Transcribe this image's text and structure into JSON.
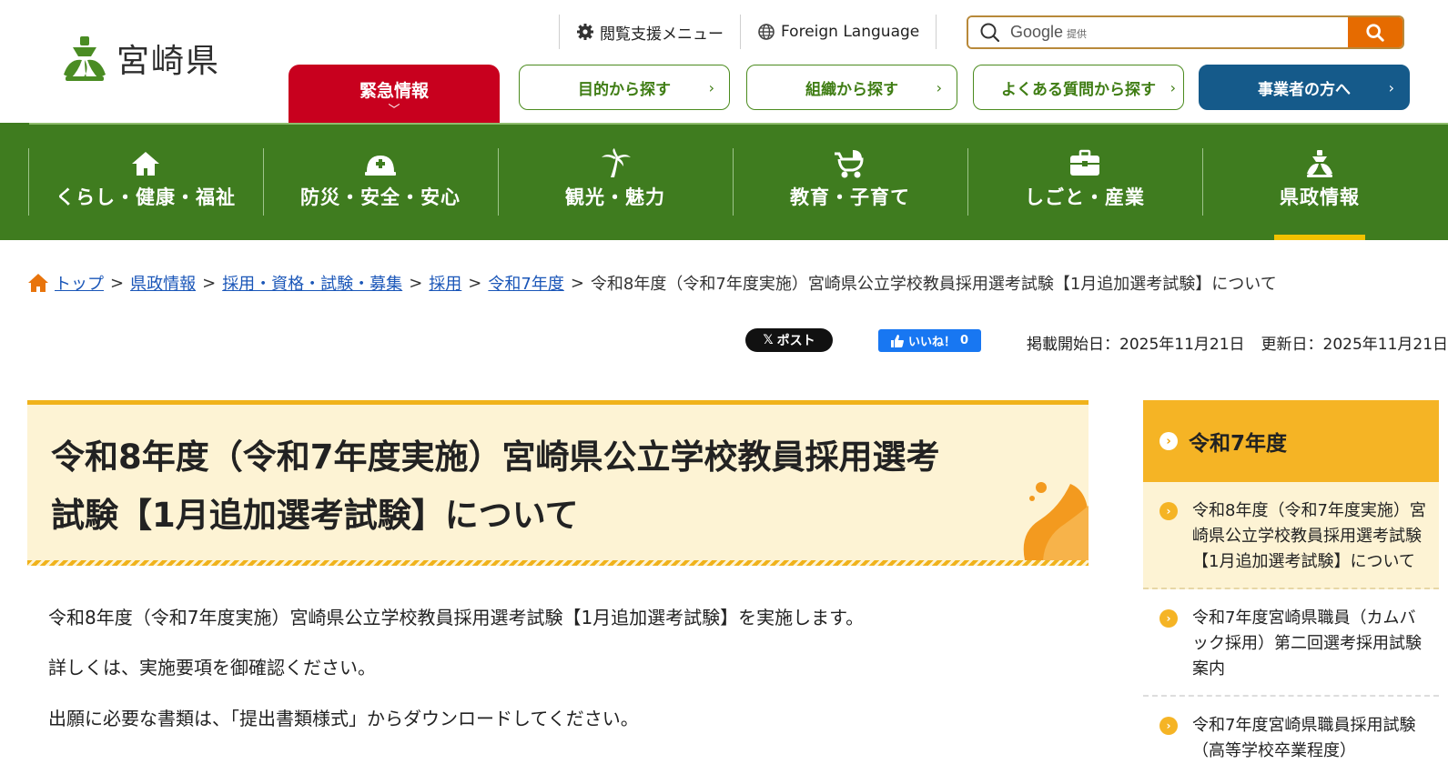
{
  "header": {
    "logo_text": "宮崎県",
    "util_assist": "閲覧支援メニュー",
    "util_foreign": "Foreign Language",
    "search_brand": "Google",
    "search_brand_sub": "提供"
  },
  "buttons": {
    "emergency": "緊急情報",
    "purpose": "目的から探す",
    "organization": "組織から探す",
    "faq": "よくある質問から探す",
    "business": "事業者の方へ"
  },
  "gnav": [
    {
      "label": "くらし・健康・福祉",
      "icon": "house-icon"
    },
    {
      "label": "防災・安全・安心",
      "icon": "helmet-icon"
    },
    {
      "label": "観光・魅力",
      "icon": "palm-tree-icon"
    },
    {
      "label": "教育・子育て",
      "icon": "stroller-icon"
    },
    {
      "label": "しごと・産業",
      "icon": "briefcase-icon"
    },
    {
      "label": "県政情報",
      "icon": "prefecture-emblem-icon"
    }
  ],
  "breadcrumb": {
    "items": [
      "トップ",
      "県政情報",
      "採用・資格・試験・募集",
      "採用",
      "令和7年度"
    ],
    "separator": ">",
    "current": "令和8年度（令和7年度実施）宮崎県公立学校教員採用選考試験【1月追加選考試験】について"
  },
  "social": {
    "x_label": "ポスト",
    "fb_label": "いいね！",
    "fb_count": "0"
  },
  "dates": {
    "published": "掲載開始日：2025年11月21日",
    "updated": "更新日：2025年11月21日"
  },
  "page": {
    "title_line1": "令和8年度（令和7年度実施）宮崎県公立学校教員採用選考",
    "title_line2": "試験【1月追加選考試験】について",
    "paragraphs": [
      "令和8年度（令和7年度実施）宮崎県公立学校教員採用選考試験【1月追加選考試験】を実施します。",
      "詳しくは、実施要項を御確認ください。",
      "出願に必要な書類は、「提出書類様式」からダウンロードしてください。"
    ]
  },
  "sidebar": {
    "heading": "令和7年度",
    "items": [
      "令和8年度（令和7年度実施）宮崎県公立学校教員採用選考試験【1月追加選考試験】について",
      "令和7年度宮崎県職員（カムバック採用）第二回選考採用試験案内",
      "令和7年度宮崎県職員採用試験（高等学校卒業程度）"
    ]
  },
  "colors": {
    "green": "#3f7c1f",
    "emergency_red": "#c8001e",
    "business_blue": "#155a8a",
    "accent_orange": "#e66b00",
    "accent_yellow": "#f0b21b"
  }
}
